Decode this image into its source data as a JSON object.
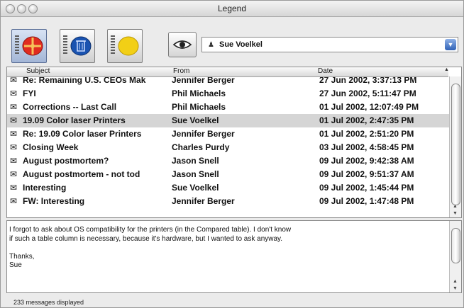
{
  "window": {
    "title": "Legend"
  },
  "toolbar": {
    "buttons": [
      {
        "name": "red-button",
        "color": "#e02b20",
        "active": true
      },
      {
        "name": "blue-button",
        "color": "#1a53b0",
        "active": false
      },
      {
        "name": "yellow-button",
        "color": "#f2cf16",
        "active": false
      }
    ],
    "contact_value": "Sue Voelkel"
  },
  "table": {
    "headers": {
      "subject": "Subject",
      "from": "From",
      "date": "Date"
    },
    "rows": [
      {
        "subject": "Re: Remaining U.S. CEOs Mak",
        "from": "Jennifer Berger",
        "date": "27 Jun 2002, 3:37:13 PM",
        "selected": false
      },
      {
        "subject": "FYI",
        "from": "Phil Michaels",
        "date": "27 Jun 2002, 5:11:47 PM",
        "selected": false
      },
      {
        "subject": "Corrections -- Last Call",
        "from": "Phil Michaels",
        "date": "01 Jul 2002, 12:07:49 PM",
        "selected": false
      },
      {
        "subject": "19.09 Color laser Printers",
        "from": "Sue Voelkel",
        "date": "01 Jul 2002, 2:47:35 PM",
        "selected": true
      },
      {
        "subject": "Re: 19.09 Color laser Printers",
        "from": "Jennifer Berger",
        "date": "01 Jul 2002, 2:51:20 PM",
        "selected": false
      },
      {
        "subject": "Closing Week",
        "from": "Charles Purdy",
        "date": "03 Jul 2002, 4:58:45 PM",
        "selected": false
      },
      {
        "subject": "August postmortem?",
        "from": "Jason Snell",
        "date": "09 Jul 2002, 9:42:38 AM",
        "selected": false
      },
      {
        "subject": "August postmortem - not tod",
        "from": "Jason Snell",
        "date": "09 Jul 2002, 9:51:37 AM",
        "selected": false
      },
      {
        "subject": "Interesting",
        "from": "Sue Voelkel",
        "date": "09 Jul 2002, 1:45:44 PM",
        "selected": false
      },
      {
        "subject": "FW: Interesting",
        "from": "Jennifer Berger",
        "date": "09 Jul 2002, 1:47:48 PM",
        "selected": false
      }
    ]
  },
  "preview": {
    "body": "I forgot to ask about OS compatibility for the printers (in the Compared table). I don't know if such a table column is necessary, because it's hardware, but I wanted to ask anyway.\n\nThanks,\nSue"
  },
  "status": {
    "text": "233 messages displayed"
  }
}
